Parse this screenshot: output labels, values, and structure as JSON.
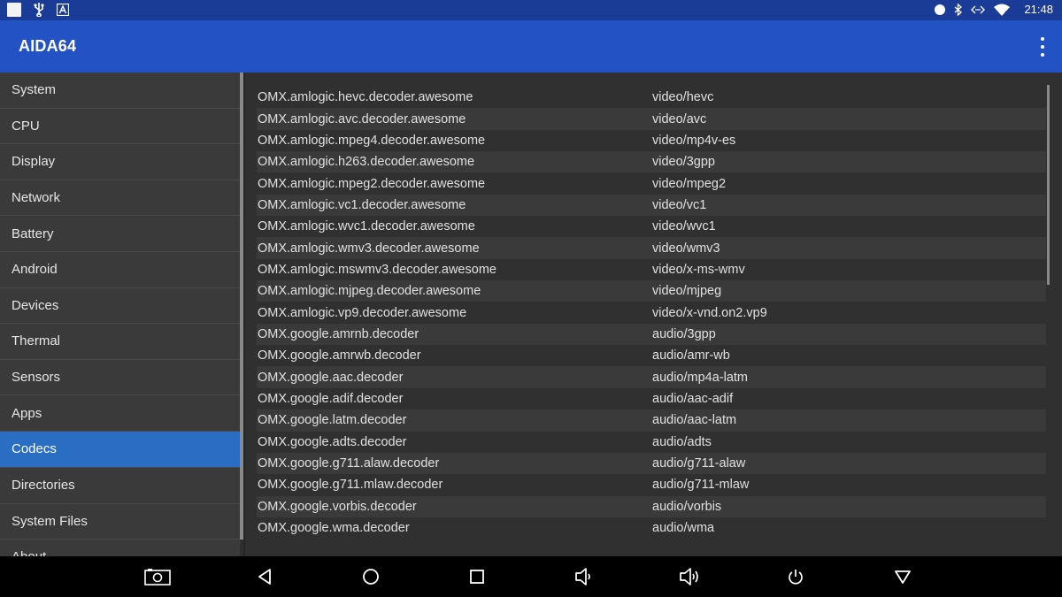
{
  "status": {
    "time": "21:48"
  },
  "app": {
    "title": "AIDA64"
  },
  "sidebar": {
    "items": [
      {
        "label": "System"
      },
      {
        "label": "CPU"
      },
      {
        "label": "Display"
      },
      {
        "label": "Network"
      },
      {
        "label": "Battery"
      },
      {
        "label": "Android"
      },
      {
        "label": "Devices"
      },
      {
        "label": "Thermal"
      },
      {
        "label": "Sensors"
      },
      {
        "label": "Apps"
      },
      {
        "label": "Codecs"
      },
      {
        "label": "Directories"
      },
      {
        "label": "System Files"
      },
      {
        "label": "About"
      }
    ],
    "active": "Codecs"
  },
  "codecs": [
    {
      "name": "OMX.amlogic.hevc.decoder.awesome",
      "type": "video/hevc"
    },
    {
      "name": "OMX.amlogic.avc.decoder.awesome",
      "type": "video/avc"
    },
    {
      "name": "OMX.amlogic.mpeg4.decoder.awesome",
      "type": "video/mp4v-es"
    },
    {
      "name": "OMX.amlogic.h263.decoder.awesome",
      "type": "video/3gpp"
    },
    {
      "name": "OMX.amlogic.mpeg2.decoder.awesome",
      "type": "video/mpeg2"
    },
    {
      "name": "OMX.amlogic.vc1.decoder.awesome",
      "type": "video/vc1"
    },
    {
      "name": "OMX.amlogic.wvc1.decoder.awesome",
      "type": "video/wvc1"
    },
    {
      "name": "OMX.amlogic.wmv3.decoder.awesome",
      "type": "video/wmv3"
    },
    {
      "name": "OMX.amlogic.mswmv3.decoder.awesome",
      "type": "video/x-ms-wmv"
    },
    {
      "name": "OMX.amlogic.mjpeg.decoder.awesome",
      "type": "video/mjpeg"
    },
    {
      "name": "OMX.amlogic.vp9.decoder.awesome",
      "type": "video/x-vnd.on2.vp9"
    },
    {
      "name": "OMX.google.amrnb.decoder",
      "type": "audio/3gpp"
    },
    {
      "name": "OMX.google.amrwb.decoder",
      "type": "audio/amr-wb"
    },
    {
      "name": "OMX.google.aac.decoder",
      "type": "audio/mp4a-latm"
    },
    {
      "name": "OMX.google.adif.decoder",
      "type": "audio/aac-adif"
    },
    {
      "name": "OMX.google.latm.decoder",
      "type": "audio/aac-latm"
    },
    {
      "name": "OMX.google.adts.decoder",
      "type": "audio/adts"
    },
    {
      "name": "OMX.google.g711.alaw.decoder",
      "type": "audio/g711-alaw"
    },
    {
      "name": "OMX.google.g711.mlaw.decoder",
      "type": "audio/g711-mlaw"
    },
    {
      "name": "OMX.google.vorbis.decoder",
      "type": "audio/vorbis"
    },
    {
      "name": "OMX.google.wma.decoder",
      "type": "audio/wma"
    }
  ],
  "navbar": {
    "buttons": [
      "screenshot-icon",
      "back-icon",
      "home-icon",
      "recents-icon",
      "volume-down-icon",
      "volume-up-icon",
      "power-icon",
      "hide-nav-icon"
    ]
  },
  "colors": {
    "status_bar": "#1a3b96",
    "app_bar": "#2352c4",
    "active_item": "#2a6ec4",
    "background": "#303030"
  }
}
